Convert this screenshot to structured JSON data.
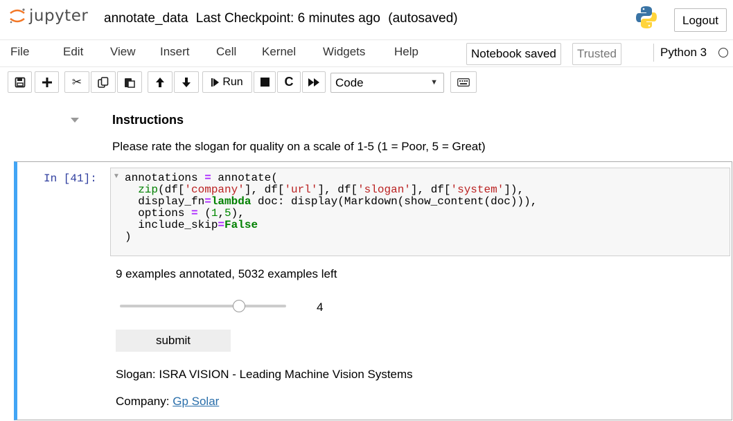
{
  "header": {
    "logo_text": "jupyter",
    "notebook_name": "annotate_data",
    "checkpoint": "Last Checkpoint: 6 minutes ago",
    "autosave": "(autosaved)",
    "logout_label": "Logout"
  },
  "menubar": {
    "items": [
      {
        "label": "File"
      },
      {
        "label": "Edit"
      },
      {
        "label": "View"
      },
      {
        "label": "Insert"
      },
      {
        "label": "Cell"
      },
      {
        "label": "Kernel"
      },
      {
        "label": "Widgets"
      },
      {
        "label": "Help"
      }
    ],
    "notebook_saved": "Notebook saved",
    "trusted": "Trusted",
    "kernel_name": "Python 3"
  },
  "toolbar": {
    "run_label": "Run",
    "cell_type": "Code"
  },
  "markdown_cell": {
    "heading": "Instructions",
    "text": "Please rate the slogan for quality on a scale of 1-5 (1 = Poor, 5 = Great)"
  },
  "code_cell": {
    "prompt": "In [41]:",
    "output": {
      "progress": "9 examples annotated, 5032 examples left",
      "slider_value": "4",
      "slider_min": 1,
      "slider_max": 5,
      "submit_label": "submit",
      "slogan": "Slogan: ISRA VISION - Leading Machine Vision Systems",
      "company_prefix": "Company:",
      "company_link": "Gp Solar"
    }
  },
  "colors": {
    "cell_active_border": "#42a5f5",
    "prompt": "#303f9f",
    "link": "#296eaa",
    "keyword": "#008000",
    "operator": "#aa22ff",
    "string": "#ba2121"
  }
}
